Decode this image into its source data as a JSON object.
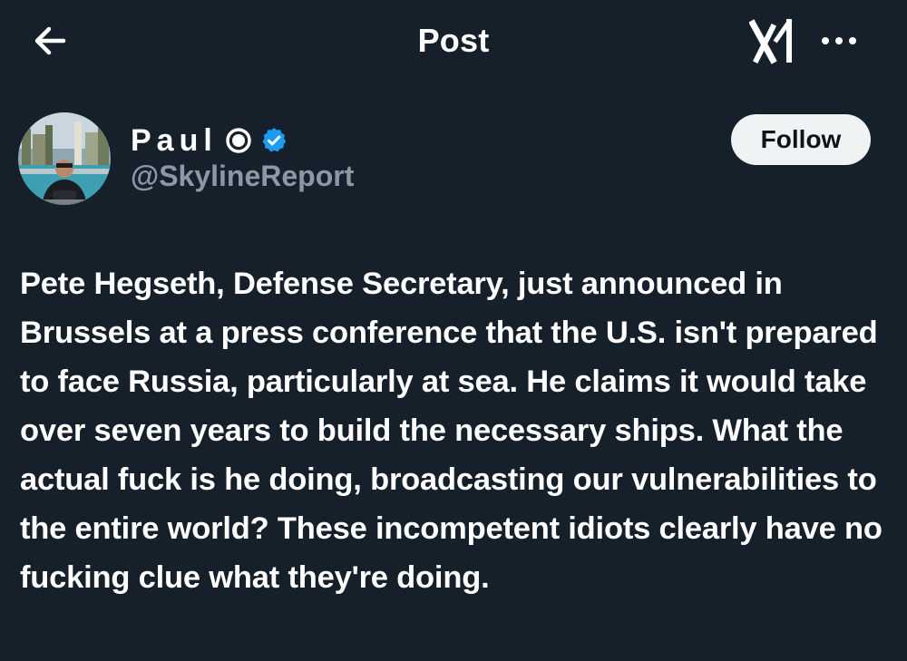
{
  "header": {
    "title": "Post",
    "back_icon": "back-arrow-icon",
    "grok_icon": "grok-icon",
    "more_icon": "more-horizontal-icon"
  },
  "author": {
    "display_name": "Paul",
    "status_icon": "circle-dot-icon",
    "verified_icon": "verified-badge-icon",
    "verified_color": "#1d9bf0",
    "handle": "@SkylineReport"
  },
  "follow_button": {
    "label": "Follow"
  },
  "post": {
    "text": "Pete Hegseth, Defense Secretary, just announced in Brussels at a press conference that the U.S. isn't prepared to face Russia, particularly at sea. He claims it would take over seven years to build the necessary ships. What the actual fuck is he doing, broadcasting our vulnerabilities to the entire world? These incompetent idiots clearly have no fucking clue what they're doing."
  },
  "colors": {
    "background": "#15202b",
    "text_primary": "#ffffff",
    "text_secondary": "#8b98a5",
    "follow_bg": "#eff3f4"
  }
}
